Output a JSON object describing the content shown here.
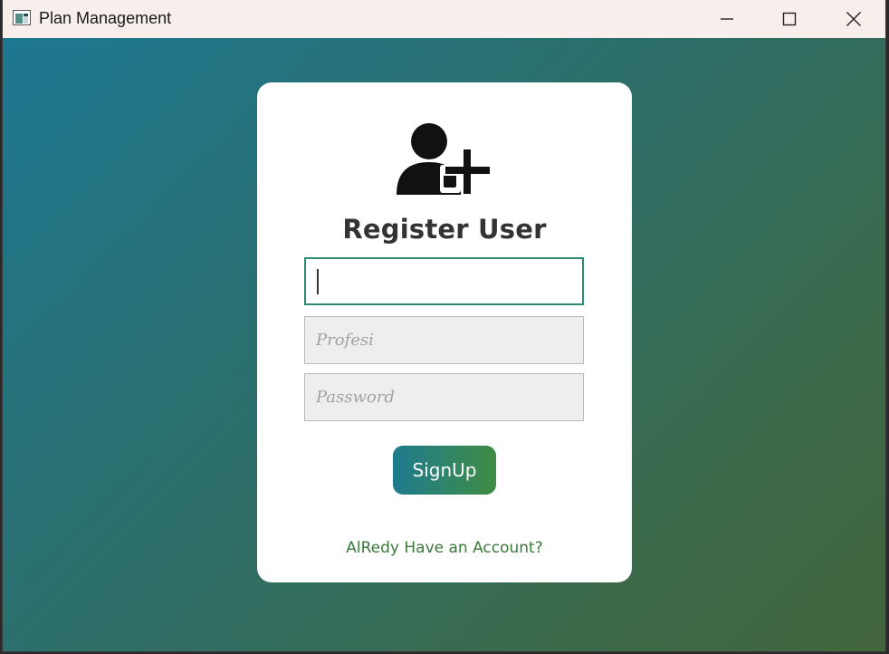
{
  "window": {
    "title": "Plan Management",
    "controls": [
      "minimize",
      "maximize",
      "close"
    ]
  },
  "form": {
    "heading": "Register User",
    "icon": "user-plus-icon",
    "fields": [
      {
        "id": "name",
        "value": "",
        "placeholder": ""
      },
      {
        "id": "profesi",
        "value": "",
        "placeholder": "Profesi"
      },
      {
        "id": "password",
        "value": "",
        "placeholder": "Password"
      }
    ],
    "signup_label": "SignUp",
    "login_link": "AlRedy Have an Account?"
  },
  "colors": {
    "background_gradient": [
      "#1e7791",
      "#2d6e69",
      "#3a6a4c",
      "#42643b"
    ],
    "button_gradient": [
      "#1e7b8e",
      "#3f8c44"
    ],
    "link": "#3a7a39",
    "focus_border": "#2f8a73"
  }
}
